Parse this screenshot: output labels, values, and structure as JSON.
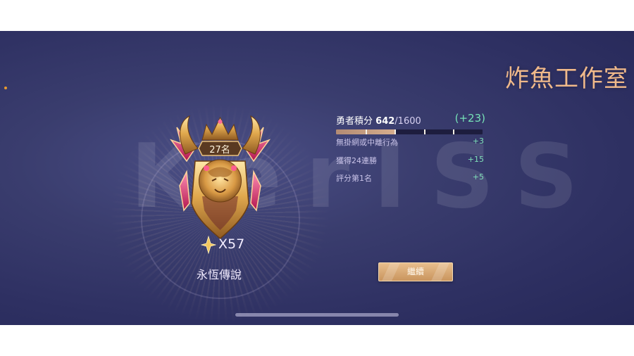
{
  "watermarks": {
    "studio": "炸魚工作室",
    "background_text": "KerISS"
  },
  "rank": {
    "position": "27名",
    "stars": "X57",
    "tier_name": "永恆傳說",
    "star_icon": "gold-star-icon",
    "badge_icon": "golden-lion-shield-icon"
  },
  "hero_points": {
    "label": "勇者積分",
    "current": "642",
    "max": "/1600",
    "gain": "(+23)",
    "progress_fraction": 0.40125,
    "segments": 5
  },
  "bonuses": [
    {
      "label": "無掛網或中離行為",
      "value": "+3"
    },
    {
      "label": "獲得24連勝",
      "value": "+15"
    },
    {
      "label": "評分第1名",
      "value": "+5"
    }
  ],
  "actions": {
    "continue_label": "繼續"
  },
  "colors": {
    "background": "#2e3062",
    "accent_gold": "#d6ad8d",
    "gain_green": "#76e2b7",
    "studio_text": "#f0b98a"
  }
}
